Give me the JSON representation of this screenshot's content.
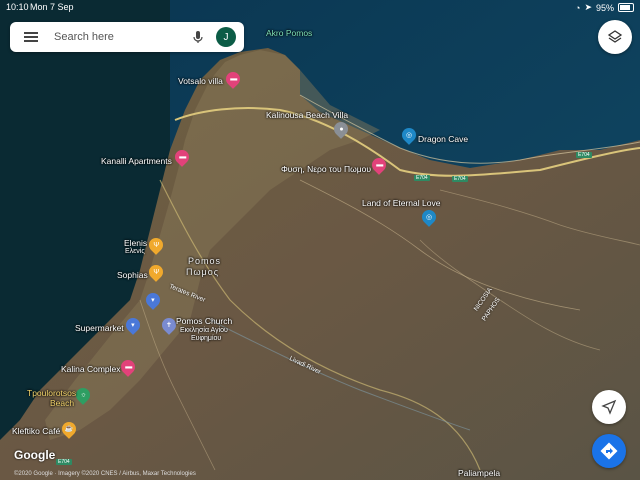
{
  "status_bar": {
    "time": "10:10",
    "date": "Mon 7 Sep",
    "battery": "95%"
  },
  "search": {
    "placeholder": "Search here",
    "avatar_initial": "J"
  },
  "icons": {
    "menu": "menu-icon",
    "mic": "microphone-icon",
    "layers": "layers-icon",
    "locate": "navigation-arrow-icon",
    "directions": "directions-icon"
  },
  "colors": {
    "hotel_pin": "#e2427a",
    "info_pin": "#1e88c7",
    "shop_pin": "#4a78d8",
    "food_pin": "#f0a92d",
    "beach_pin": "#2e9e62",
    "church_pin": "#7a8bd0",
    "accent_blue": "#1a73e8"
  },
  "places": {
    "akro_pomos": "Akro Pomos",
    "votsalo_villa": "Votsalo villa",
    "kalinousa": "Kalinousa Beach Villa",
    "dragon_cave": "Dragon Cave",
    "kanalli": "Kanalli Apartments",
    "fysi": "Φυση, Νερο του Πωμου",
    "land_eternal": "Land of Eternal Love",
    "elenis": "Elenis",
    "elenis_gr": "Ελενίς",
    "sophias": "Sophias",
    "pomos": "Pomos",
    "pomos_gr": "Πωμος",
    "terates": "Terates River",
    "supermarket": "Supermarket",
    "pomos_church": "Pomos Church",
    "church_gr1": "Εκκλησία Αγίου",
    "church_gr2": "Ευφημίου",
    "kalina": "Kalina Complex",
    "tpoulorotsos1": "Tpoulorotsos",
    "tpoulorotsos2": "Beach",
    "kleftiko": "Kleftiko Café",
    "livadi": "Livadi River",
    "nicosia1": "NICOSIA",
    "nicosia2": "PAPHOS",
    "paliampela": "Paliampela"
  },
  "road_codes": {
    "e704_a": "E704",
    "e704_b": "E704",
    "e704_c": "E704",
    "e704_d": "E704"
  },
  "brand": {
    "logo": "Google",
    "copyright": "©2020 Google · Imagery ©2020 CNES / Airbus, Maxar Technologies"
  }
}
